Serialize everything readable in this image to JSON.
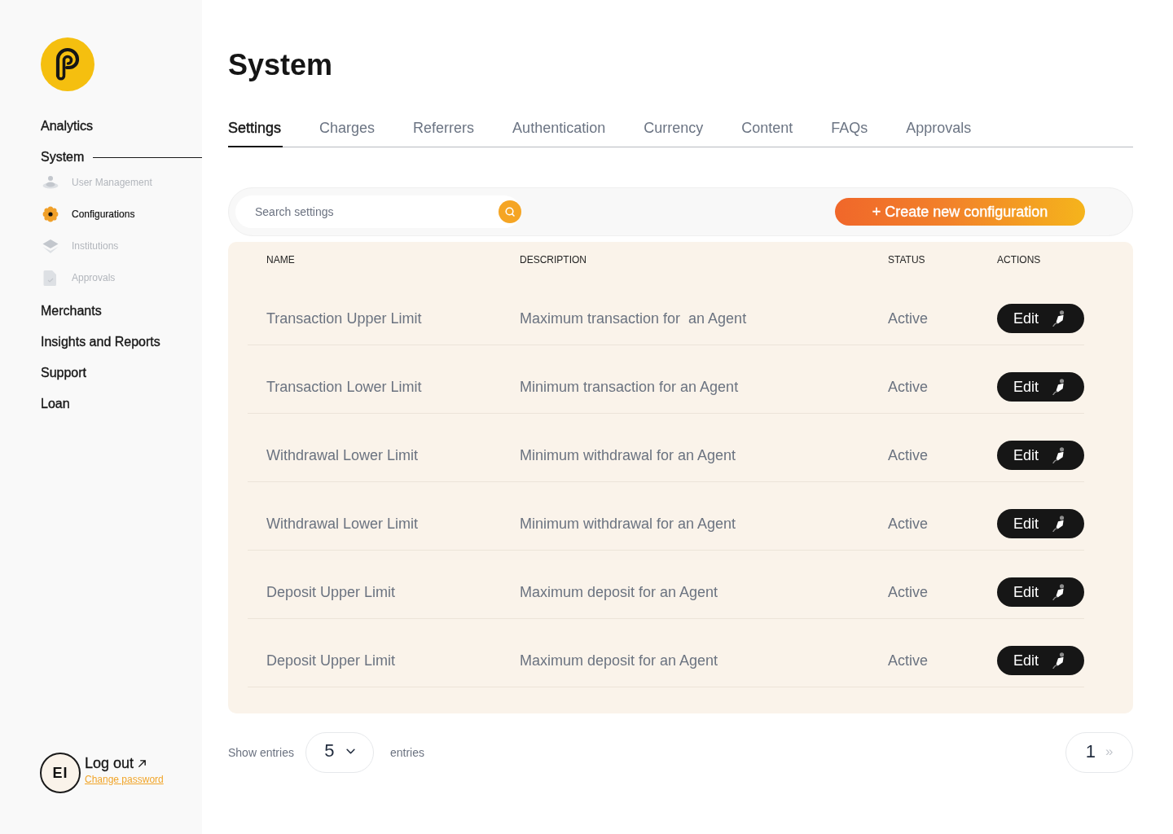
{
  "sidebar": {
    "items": [
      {
        "label": "Analytics",
        "selected": false
      },
      {
        "label": "System",
        "selected": true,
        "children": [
          {
            "label": "User Management",
            "selected": false
          },
          {
            "label": "Configurations",
            "selected": true
          },
          {
            "label": "Institutions",
            "selected": false
          },
          {
            "label": "Approvals",
            "selected": false
          }
        ]
      },
      {
        "label": "Merchants",
        "selected": false
      },
      {
        "label": "Insights and Reports",
        "selected": false
      },
      {
        "label": "Support",
        "selected": false
      },
      {
        "label": "Loan",
        "selected": false
      }
    ],
    "user": {
      "initials": "EI",
      "logout": "Log out",
      "change_password": "Change password"
    }
  },
  "page": {
    "title": "System"
  },
  "tabs": [
    {
      "label": "Settings",
      "selected": true
    },
    {
      "label": "Charges",
      "selected": false
    },
    {
      "label": "Referrers",
      "selected": false
    },
    {
      "label": "Authentication",
      "selected": false
    },
    {
      "label": "Currency",
      "selected": false
    },
    {
      "label": "Content",
      "selected": false
    },
    {
      "label": "FAQs",
      "selected": false
    },
    {
      "label": "Approvals",
      "selected": false
    }
  ],
  "search": {
    "placeholder": "Search settings"
  },
  "create_button": "+ Create new configuration",
  "table": {
    "columns": [
      "NAME",
      "DESCRIPTION",
      "STATUS",
      "ACTIONS"
    ],
    "rows": [
      {
        "name": "Transaction Upper Limit",
        "description": "Maximum transaction for  an Agent",
        "status": "Active",
        "action": "Edit"
      },
      {
        "name": "Transaction Lower Limit",
        "description": "Minimum transaction for an Agent",
        "status": "Active",
        "action": "Edit"
      },
      {
        "name": "Withdrawal Lower Limit",
        "description": "Minimum withdrawal for an Agent",
        "status": "Active",
        "action": "Edit"
      },
      {
        "name": "Withdrawal Lower Limit",
        "description": "Minimum withdrawal for an Agent",
        "status": "Active",
        "action": "Edit"
      },
      {
        "name": "Deposit Upper Limit",
        "description": "Maximum deposit for an Agent",
        "status": "Active",
        "action": "Edit"
      },
      {
        "name": "Deposit Upper Limit",
        "description": "Maximum deposit for an Agent",
        "status": "Active",
        "action": "Edit"
      }
    ]
  },
  "footer": {
    "show_label": "Show entries",
    "page_size": "5",
    "entries_label": "entries",
    "current_page": "1",
    "next": {
      "label": "»",
      "disabled": true
    }
  }
}
